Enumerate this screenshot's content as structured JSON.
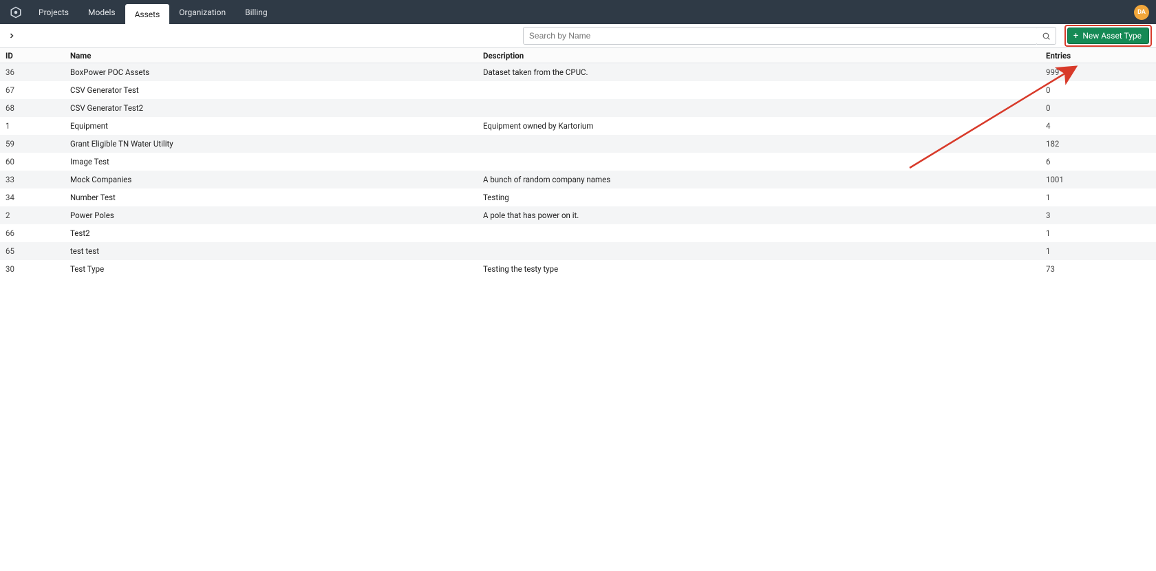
{
  "nav": {
    "tabs": [
      {
        "label": "Projects"
      },
      {
        "label": "Models"
      },
      {
        "label": "Assets"
      },
      {
        "label": "Organization"
      },
      {
        "label": "Billing"
      }
    ],
    "active_index": 2,
    "avatar_text": "DA"
  },
  "toolbar": {
    "search_placeholder": "Search by Name",
    "new_button_label": "New Asset Type"
  },
  "table": {
    "headers": {
      "id": "ID",
      "name": "Name",
      "description": "Description",
      "entries": "Entries"
    },
    "rows": [
      {
        "id": "36",
        "name": "BoxPower POC Assets",
        "description": "Dataset taken from the CPUC.",
        "entries": "999"
      },
      {
        "id": "67",
        "name": "CSV Generator Test",
        "description": "",
        "entries": "0"
      },
      {
        "id": "68",
        "name": "CSV Generator Test2",
        "description": "",
        "entries": "0"
      },
      {
        "id": "1",
        "name": "Equipment",
        "description": "Equipment owned by Kartorium",
        "entries": "4"
      },
      {
        "id": "59",
        "name": "Grant Eligible TN Water Utility",
        "description": "",
        "entries": "182"
      },
      {
        "id": "60",
        "name": "Image Test",
        "description": "",
        "entries": "6"
      },
      {
        "id": "33",
        "name": "Mock Companies",
        "description": "A bunch of random company names",
        "entries": "1001"
      },
      {
        "id": "34",
        "name": "Number Test",
        "description": "Testing",
        "entries": "1"
      },
      {
        "id": "2",
        "name": "Power Poles",
        "description": "A pole that has power on it.",
        "entries": "3"
      },
      {
        "id": "66",
        "name": "Test2",
        "description": "",
        "entries": "1"
      },
      {
        "id": "65",
        "name": "test test",
        "description": "",
        "entries": "1"
      },
      {
        "id": "30",
        "name": "Test Type",
        "description": "Testing the testy type",
        "entries": "73"
      }
    ]
  }
}
